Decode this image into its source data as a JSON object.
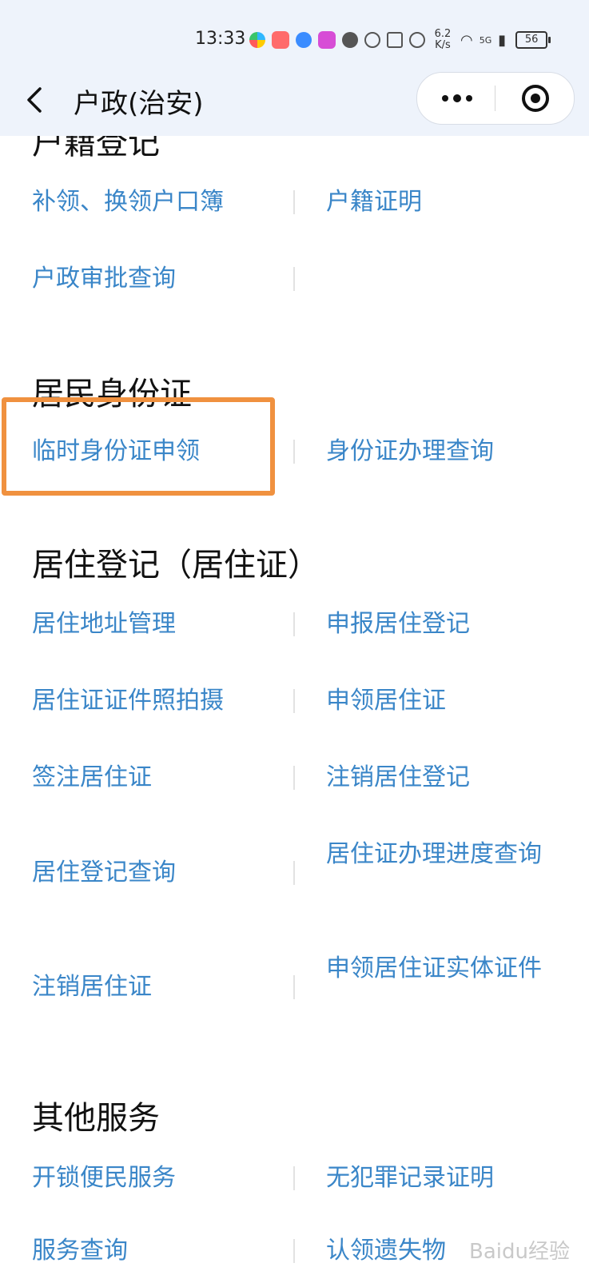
{
  "status_bar": {
    "time": "13:33",
    "speed": "6.2 K/s",
    "network": "5G",
    "battery": "56"
  },
  "nav": {
    "title": "户政(治安)"
  },
  "sections": {
    "household": {
      "title": "户籍登记",
      "items": [
        "补领、换领户口簿",
        "户籍证明",
        "户政审批查询"
      ]
    },
    "id_card": {
      "title": "居民身份证",
      "items": [
        "临时身份证申领",
        "身份证办理查询"
      ]
    },
    "residence": {
      "title": "居住登记（居住证）",
      "items": [
        "居住地址管理",
        "申报居住登记",
        "居住证证件照拍摄",
        "申领居住证",
        "签注居住证",
        "注销居住登记",
        "居住登记查询",
        "居住证办理进度查询",
        "注销居住证",
        "申领居住证实体证件"
      ]
    },
    "other": {
      "title": "其他服务",
      "items": [
        "开锁便民服务",
        "无犯罪记录证明",
        "服务查询",
        "认领遗失物"
      ]
    }
  },
  "watermark": "Baidu经验",
  "colors": {
    "link": "#3a86c8",
    "highlight": "#f0913f",
    "header_bg": "#eef3fb"
  }
}
